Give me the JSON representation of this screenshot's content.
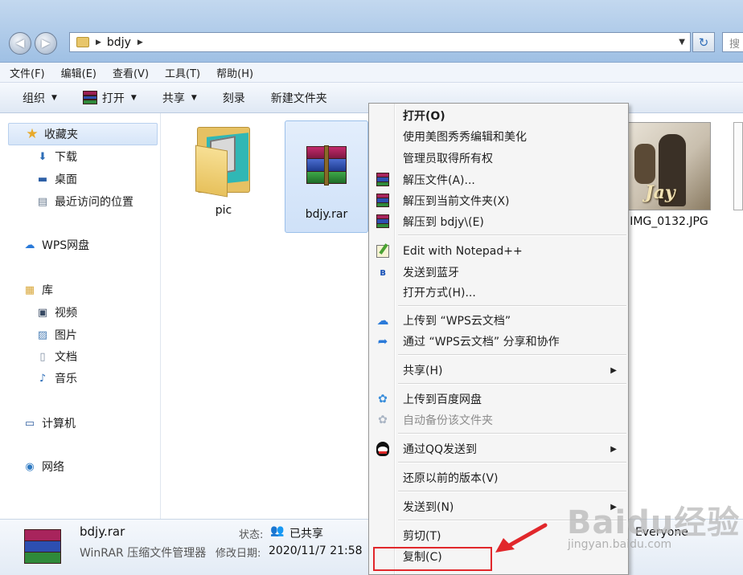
{
  "address": {
    "crumb": "bdjy",
    "search_placeholder": "搜"
  },
  "menubar": [
    "文件(F)",
    "编辑(E)",
    "查看(V)",
    "工具(T)",
    "帮助(H)"
  ],
  "toolbar": {
    "organize": "组织",
    "open": "打开",
    "share": "共享",
    "burn": "刻录",
    "new_folder": "新建文件夹"
  },
  "sidebar": {
    "favorites": "收藏夹",
    "downloads": "下载",
    "desktop": "桌面",
    "recent": "最近访问的位置",
    "wps_cloud": "WPS网盘",
    "libraries": "库",
    "videos": "视频",
    "pictures": "图片",
    "documents": "文档",
    "music": "音乐",
    "computer": "计算机",
    "network": "网络"
  },
  "files": [
    {
      "name": "pic",
      "type": "folder"
    },
    {
      "name": "bdjy.rar",
      "type": "rar",
      "selected": true
    },
    {
      "name": "IMG_0132.JPG",
      "type": "image",
      "thumb_text": "Jay"
    }
  ],
  "status": {
    "name": "bdjy.rar",
    "type": "WinRAR 压缩文件管理器",
    "state_label": "状态:",
    "state_value": "已共享",
    "date_label": "修改日期:",
    "date_value": "2020/11/7 21:58",
    "shared_with": "Everyone"
  },
  "context_menu": [
    {
      "label": "打开(O)",
      "icon": "none",
      "bold": true
    },
    {
      "label": "使用美图秀秀编辑和美化",
      "icon": "none"
    },
    {
      "label": "管理员取得所有权",
      "icon": "none"
    },
    {
      "label": "解压文件(A)...",
      "icon": "winrar-icon"
    },
    {
      "label": "解压到当前文件夹(X)",
      "icon": "winrar-icon"
    },
    {
      "label": "解压到 bdjy\\(E)",
      "icon": "winrar-icon"
    },
    {
      "label": "Edit with Notepad++",
      "icon": "notepad-plus-plus-icon"
    },
    {
      "label": "发送到蓝牙",
      "icon": "bluetooth-icon"
    },
    {
      "label": "打开方式(H)...",
      "icon": "none"
    },
    {
      "label": "上传到 “WPS云文档”",
      "icon": "cloud-upload-icon"
    },
    {
      "label": "通过 “WPS云文档” 分享和协作",
      "icon": "share-icon"
    },
    {
      "label": "共享(H)",
      "icon": "none",
      "submenu": true
    },
    {
      "label": "上传到百度网盘",
      "icon": "baidu-netdisk-icon"
    },
    {
      "label": "自动备份该文件夹",
      "icon": "baidu-netdisk-icon",
      "disabled": true
    },
    {
      "label": "通过QQ发送到",
      "icon": "qq-icon",
      "submenu": true
    },
    {
      "label": "还原以前的版本(V)",
      "icon": "none"
    },
    {
      "label": "发送到(N)",
      "icon": "none",
      "submenu": true
    },
    {
      "label": "剪切(T)",
      "icon": "none"
    },
    {
      "label": "复制(C)",
      "icon": "none",
      "highlighted": true
    }
  ],
  "watermark": {
    "logo": "Baidu经验",
    "sub": "jingyan.baidu.com"
  },
  "colors": {
    "highlight_box": "#e1272b",
    "selection": "#cfe1f8"
  }
}
